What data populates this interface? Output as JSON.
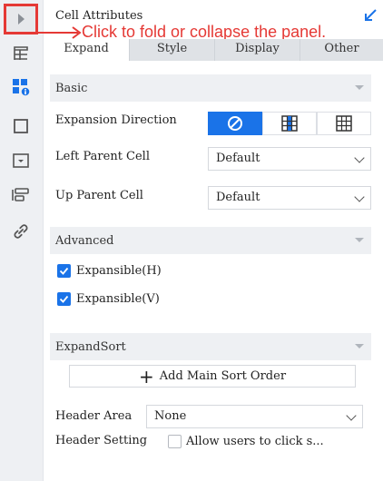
{
  "panel": {
    "title": "Cell Attributes",
    "annotation": "Click to fold or collapse the panel."
  },
  "sidebar": {
    "icons": [
      "collapse-arrow-icon",
      "cell-element-icon",
      "cell-attributes-icon",
      "border-frame-icon",
      "widget-icon",
      "condition-icon",
      "hyperlink-icon"
    ]
  },
  "tabs": [
    {
      "label": "Expand",
      "active": true
    },
    {
      "label": "Style",
      "active": false
    },
    {
      "label": "Display",
      "active": false
    },
    {
      "label": "Other",
      "active": false
    }
  ],
  "basic": {
    "header": "Basic",
    "expansion_direction_label": "Expansion Direction",
    "left_parent_label": "Left Parent Cell",
    "left_parent_value": "Default",
    "up_parent_label": "Up Parent Cell",
    "up_parent_value": "Default"
  },
  "advanced": {
    "header": "Advanced",
    "expansible_h": "Expansible(H)",
    "expansible_v": "Expansible(V)"
  },
  "expand_sort": {
    "header": "ExpandSort",
    "add_button": "Add Main Sort Order",
    "header_area_label": "Header Area",
    "header_area_value": "None",
    "header_setting_label": "Header Setting",
    "allow_click_label": "Allow users to click s..."
  },
  "colors": {
    "accent": "#1a73e8",
    "annotation": "#e53935"
  }
}
